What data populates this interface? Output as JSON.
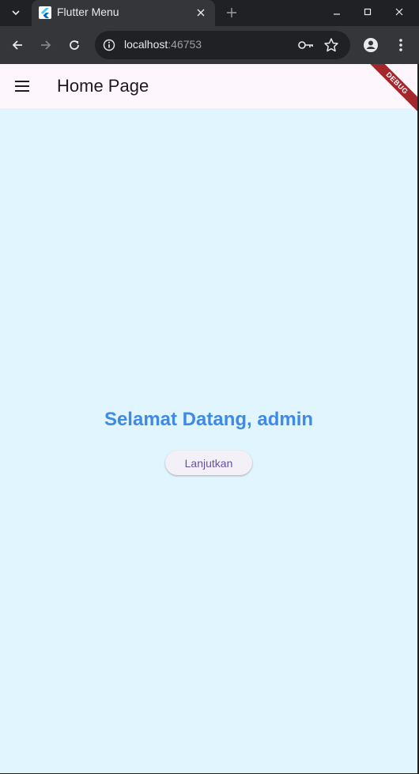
{
  "browser": {
    "tab_title": "Flutter Menu",
    "url_host": "localhost",
    "url_port": ":46753"
  },
  "app": {
    "title": "Home Page",
    "debug_label": "DEBUG",
    "welcome_text": "Selamat Datang, admin",
    "continue_label": "Lanjutkan"
  },
  "colors": {
    "page_background": "#e0f5fd",
    "appbar_background": "#fdf7fd",
    "welcome_text": "#3d8ae8",
    "button_text": "#6750a4",
    "debug_banner": "#a5262c"
  }
}
